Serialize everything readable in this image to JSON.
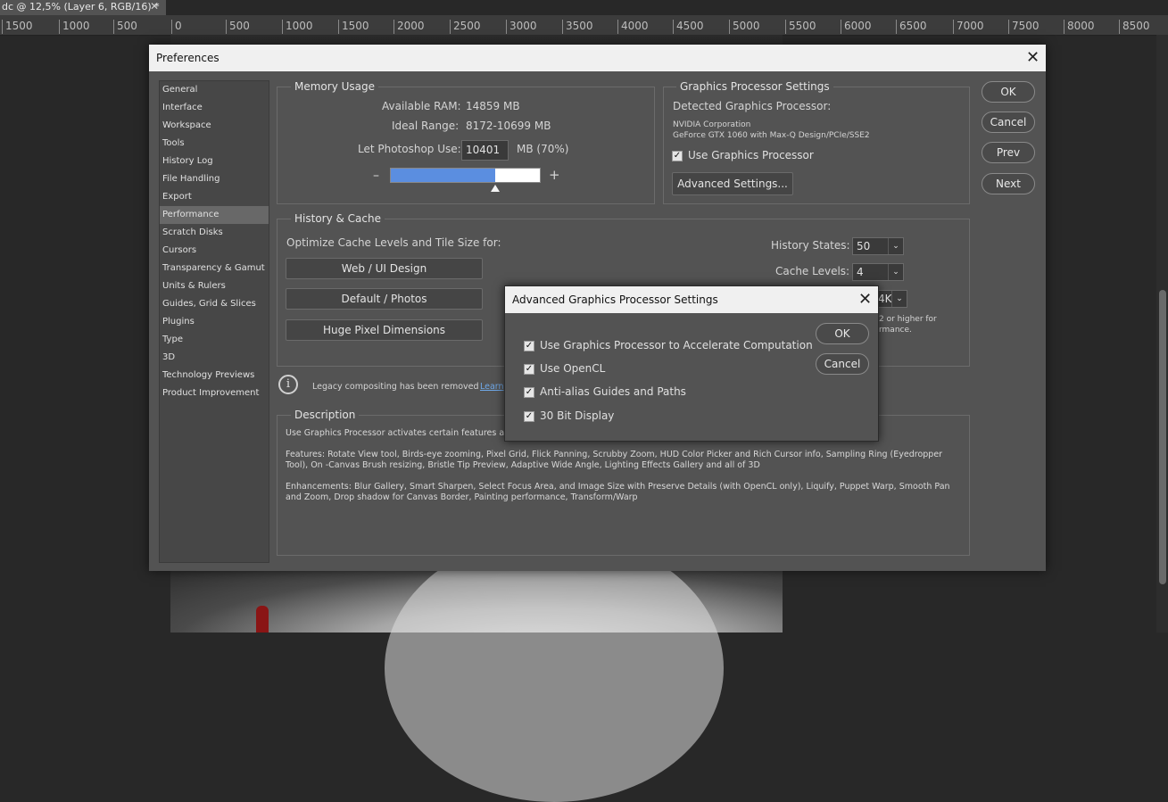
{
  "doc_tab": {
    "title": "dc @ 12,5% (Layer 6, RGB/16) *",
    "close": "✕"
  },
  "ruler": {
    "ticks": [
      "1500",
      "1000",
      "500",
      "0",
      "500",
      "1000",
      "1500",
      "2000",
      "2500",
      "3000",
      "3500",
      "4000",
      "4500",
      "5000",
      "5500",
      "6000",
      "6500",
      "7000",
      "7500",
      "8000",
      "8500"
    ]
  },
  "preferences": {
    "title": "Preferences",
    "close_icon": "close-icon",
    "sidebar": [
      "General",
      "Interface",
      "Workspace",
      "Tools",
      "History Log",
      "File Handling",
      "Export",
      "Performance",
      "Scratch Disks",
      "Cursors",
      "Transparency & Gamut",
      "Units & Rulers",
      "Guides, Grid & Slices",
      "Plugins",
      "Type",
      "3D",
      "Technology Previews",
      "Product Improvement"
    ],
    "selected_index": 7,
    "memory": {
      "title": "Memory Usage",
      "available_label": "Available RAM:",
      "available_value": "14859 MB",
      "ideal_label": "Ideal Range:",
      "ideal_value": "8172-10699 MB",
      "let_label": "Let Photoshop Use:",
      "let_value": "10401",
      "let_unit": "MB (70%)",
      "slider_fraction": 0.7,
      "minus": "–",
      "plus": "+"
    },
    "gpu": {
      "title": "Graphics Processor Settings",
      "detected_label": "Detected Graphics Processor:",
      "vendor": "NVIDIA Corporation",
      "model": "GeForce GTX 1060 with Max-Q Design/PCIe/SSE2",
      "use_label": "Use Graphics Processor",
      "use_checked": true,
      "advanced_button": "Advanced Settings..."
    },
    "buttons": {
      "ok": "OK",
      "cancel": "Cancel",
      "prev": "Prev",
      "next": "Next"
    },
    "history_cache": {
      "title": "History & Cache",
      "optimize_label": "Optimize Cache Levels and Tile Size for:",
      "btn_web": "Web / UI Design",
      "btn_default": "Default / Photos",
      "btn_huge": "Huge Pixel Dimensions",
      "history_states_label": "History States:",
      "history_states_value": "50",
      "cache_levels_label": "Cache Levels:",
      "cache_levels_value": "4",
      "tile_value": "4K",
      "note_line1": "2 or higher for",
      "note_line2": "rmance."
    },
    "legacy": {
      "text": "Legacy compositing has been removed",
      "link": "Learn"
    },
    "description": {
      "title": "Description",
      "p1": "Use Graphics Processor activates certain features and",
      "p2": "Features: Rotate View tool, Birds-eye zooming, Pixel Grid, Flick Panning, Scrubby Zoom, HUD Color Picker and Rich Cursor info, Sampling Ring (Eyedropper Tool), On -Canvas Brush resizing, Bristle Tip Preview, Adaptive Wide Angle, Lighting Effects Gallery and all of 3D",
      "p3": "Enhancements: Blur Gallery, Smart Sharpen, Select Focus Area, and Image Size with Preserve Details (with OpenCL only), Liquify, Puppet Warp, Smooth Pan and Zoom, Drop shadow for Canvas Border, Painting performance, Transform/Warp"
    }
  },
  "advanced": {
    "title": "Advanced Graphics Processor Settings",
    "options": [
      {
        "label": "Use Graphics Processor to Accelerate Computation",
        "checked": true
      },
      {
        "label": "Use OpenCL",
        "checked": true
      },
      {
        "label": "Anti-alias Guides and Paths",
        "checked": true
      },
      {
        "label": "30 Bit Display",
        "checked": true
      }
    ],
    "ok": "OK",
    "cancel": "Cancel"
  },
  "colors": {
    "slider_fill": "#5b8ee0",
    "dialog_bg": "#535353",
    "titlebar_bg": "#f0f0f0",
    "link": "#6fa8e8"
  }
}
